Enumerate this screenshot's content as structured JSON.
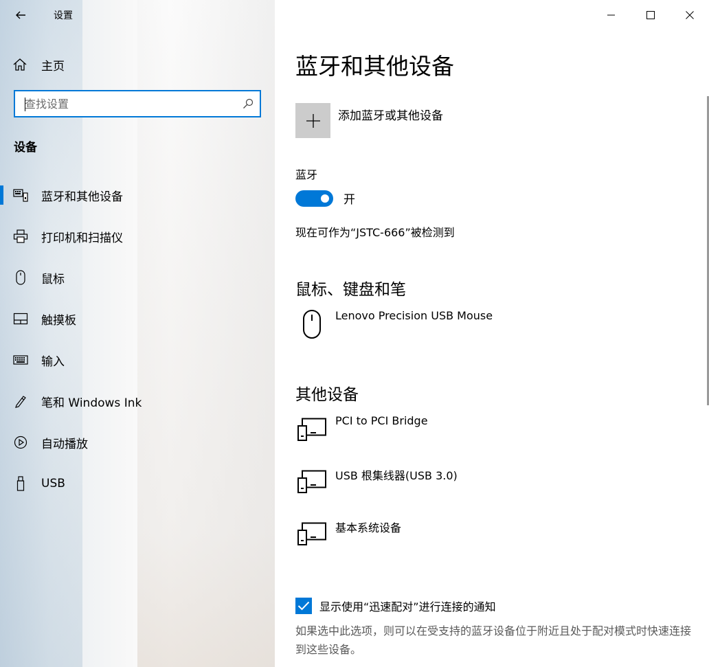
{
  "app": {
    "title": "设置",
    "back_icon": "back-arrow-icon"
  },
  "sidebar": {
    "home_label": "主页",
    "search_placeholder": "查找设置",
    "section_title": "设备",
    "items": [
      {
        "label": "蓝牙和其他设备",
        "icon": "bluetooth-devices-icon",
        "active": true
      },
      {
        "label": "打印机和扫描仪",
        "icon": "printer-icon",
        "active": false
      },
      {
        "label": "鼠标",
        "icon": "mouse-icon",
        "active": false
      },
      {
        "label": "触摸板",
        "icon": "touchpad-icon",
        "active": false
      },
      {
        "label": "输入",
        "icon": "keyboard-icon",
        "active": false
      },
      {
        "label": "笔和 Windows Ink",
        "icon": "pen-icon",
        "active": false
      },
      {
        "label": "自动播放",
        "icon": "autoplay-icon",
        "active": false
      },
      {
        "label": "USB",
        "icon": "usb-icon",
        "active": false
      }
    ]
  },
  "main": {
    "title": "蓝牙和其他设备",
    "add_device_label": "添加蓝牙或其他设备",
    "bluetooth": {
      "label": "蓝牙",
      "state": "开",
      "on": true,
      "discoverable_text": "现在可作为“JSTC-666”被检测到"
    },
    "mouse_section": {
      "title": "鼠标、键盘和笔",
      "devices": [
        "Lenovo Precision USB Mouse"
      ]
    },
    "other_section": {
      "title": "其他设备",
      "devices": [
        "PCI to PCI Bridge",
        "USB 根集线器(USB 3.0)",
        "基本系统设备"
      ]
    },
    "swift_pair": {
      "label": "显示使用“迅速配对”进行连接的通知",
      "checked": true,
      "description": "如果选中此选项，则可以在受支持的蓝牙设备位于附近且处于配对模式时快速连接到这些设备。"
    }
  },
  "colors": {
    "accent": "#0078d7",
    "tile": "#cccccc"
  }
}
